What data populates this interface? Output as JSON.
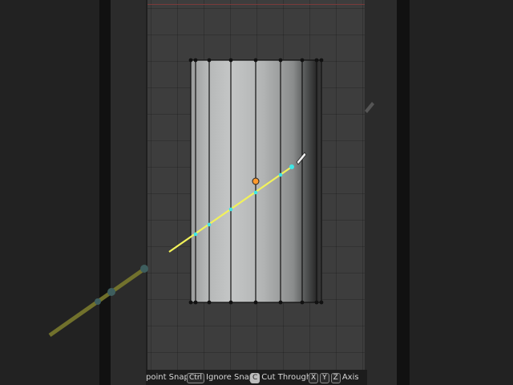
{
  "statusbar": {
    "items": [
      {
        "key": "",
        "label": "point Snap"
      },
      {
        "key": "Ctrl",
        "label": "Ignore Snap"
      },
      {
        "key": "C",
        "label": "Cut Through"
      },
      {
        "keys": [
          "X",
          "Y",
          "Z"
        ],
        "label": "Axis"
      }
    ]
  },
  "icons": {
    "knife_cursor": "knife-cursor-icon",
    "side_tool": "knife-tool-icon"
  },
  "colors": {
    "knife_line": "#f2f25a",
    "cut_points": "#3fe8e8",
    "origin": "#ff9a2e",
    "mesh_edges": "#111111"
  }
}
